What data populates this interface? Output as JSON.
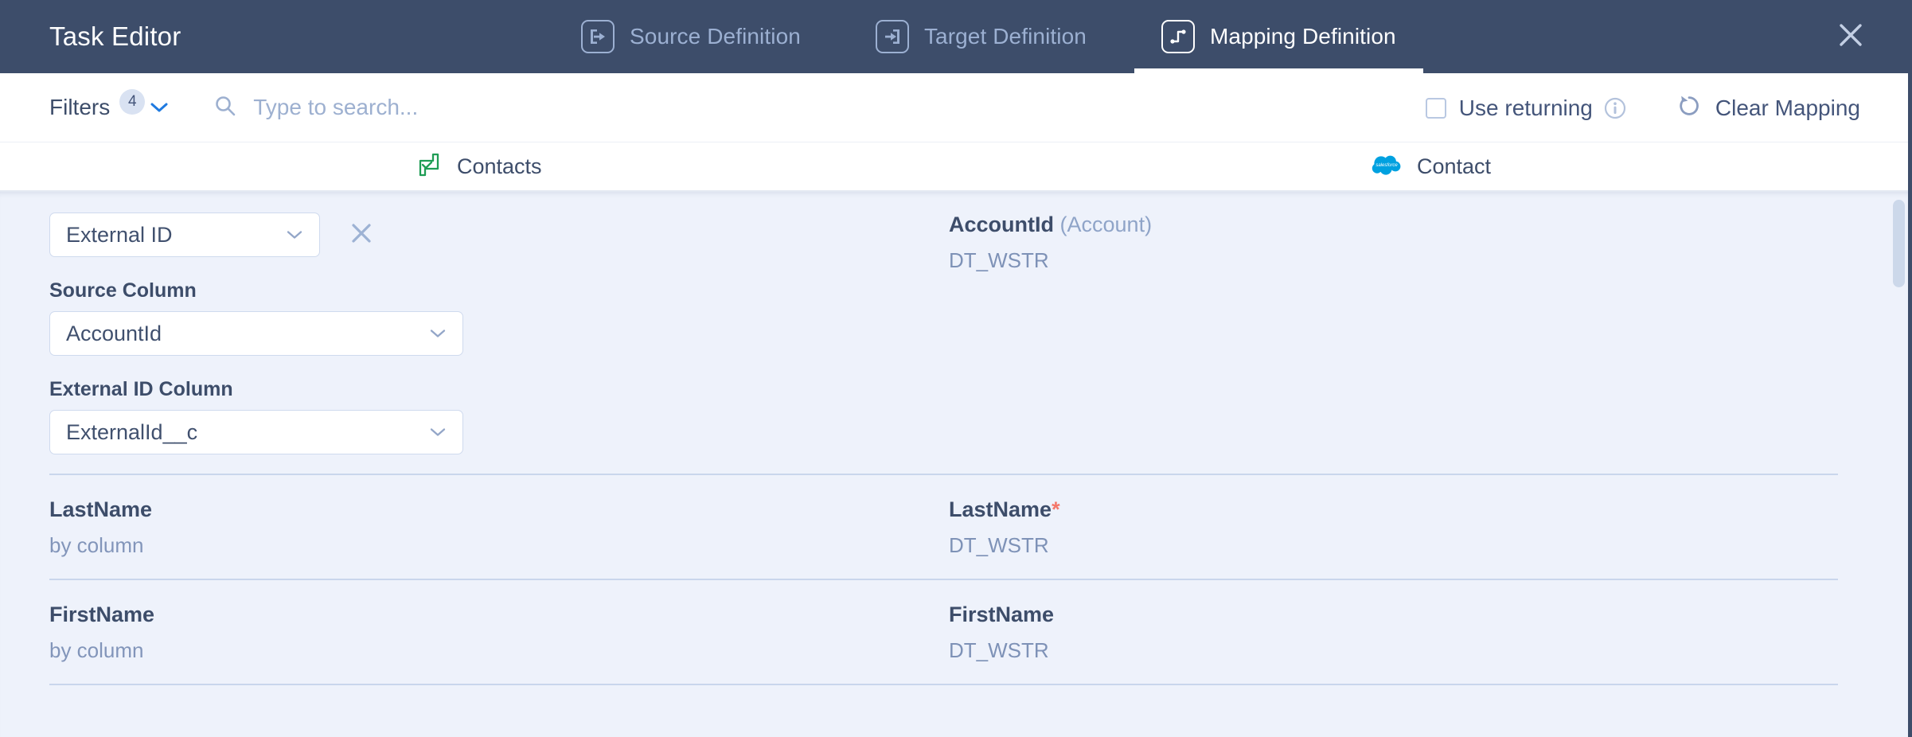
{
  "header": {
    "title": "Task Editor",
    "close_icon": "close-icon",
    "tabs": [
      {
        "label": "Source Definition",
        "icon": "source-definition-icon",
        "active": false
      },
      {
        "label": "Target Definition",
        "icon": "target-definition-icon",
        "active": false
      },
      {
        "label": "Mapping Definition",
        "icon": "mapping-definition-icon",
        "active": true
      }
    ]
  },
  "toolbar": {
    "filters_label": "Filters",
    "filters_count": "4",
    "filters_chevron_icon": "chevron-down-icon",
    "search_icon": "search-icon",
    "search_value": "",
    "search_placeholder": "Type to search...",
    "use_returning_label": "Use returning",
    "use_returning_checked": false,
    "info_icon": "info-icon",
    "clear_mapping_label": "Clear Mapping",
    "clear_mapping_icon": "reset-circular-arrow-icon"
  },
  "columns": {
    "source": {
      "label": "Contacts",
      "icon": "csv-file-green-icon"
    },
    "target": {
      "label": "Contact",
      "icon": "salesforce-cloud-icon"
    }
  },
  "mappings": [
    {
      "type": "expanded",
      "source": {
        "mode_value": "External ID",
        "mode_chevron_icon": "chevron-down-icon",
        "remove_icon": "close-icon",
        "source_column_label": "Source Column",
        "source_column_value": "AccountId",
        "source_column_chevron_icon": "chevron-down-icon",
        "external_id_column_label": "External ID Column",
        "external_id_column_value": "ExternalId__c",
        "external_id_column_chevron_icon": "chevron-down-icon"
      },
      "target": {
        "name": "AccountId",
        "parent": "(Account)",
        "required": false,
        "datatype": "DT_WSTR"
      }
    },
    {
      "type": "simple",
      "source": {
        "name": "LastName",
        "mode": "by column"
      },
      "target": {
        "name": "LastName",
        "parent": "",
        "required": true,
        "datatype": "DT_WSTR"
      }
    },
    {
      "type": "simple",
      "source": {
        "name": "FirstName",
        "mode": "by column"
      },
      "target": {
        "name": "FirstName",
        "parent": "",
        "required": false,
        "datatype": "DT_WSTR"
      }
    }
  ],
  "colors": {
    "header_bg": "#3d4d6a",
    "content_bg": "#eef2fb",
    "accent_blue": "#1f7ae0",
    "required_red": "#f4776a",
    "source_green": "#1f9d55",
    "salesforce_blue": "#00a1e0"
  }
}
